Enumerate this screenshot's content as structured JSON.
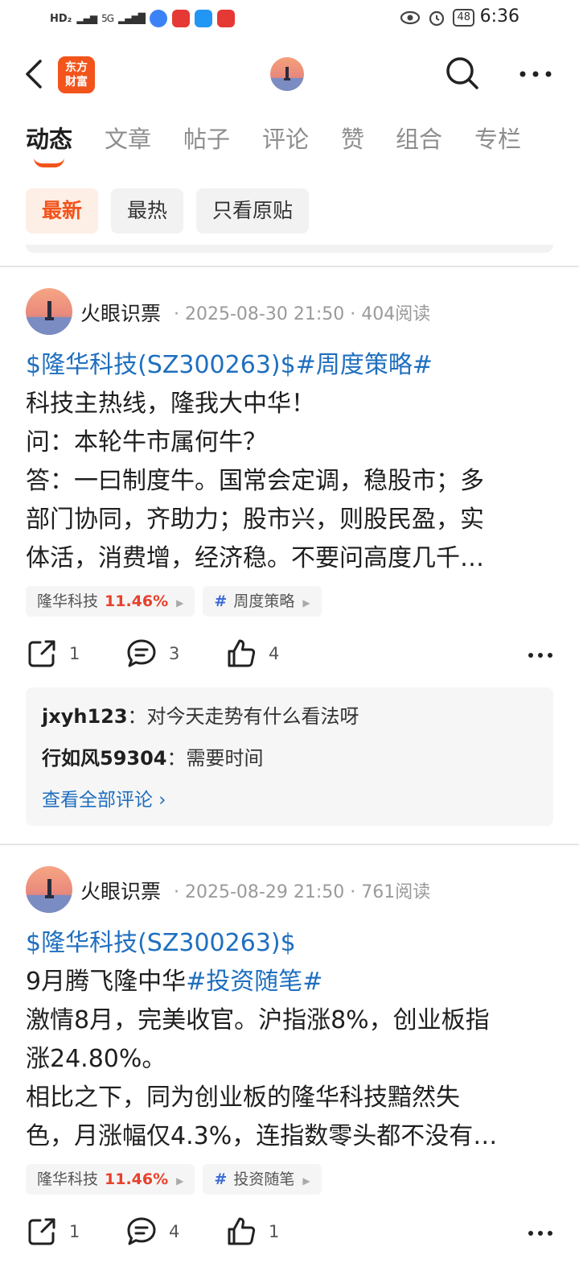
{
  "status_bar": {
    "hd_label": "HD₂",
    "signal_label": "5G",
    "battery": "48",
    "time": "6:36",
    "apps": [
      "#3b82f6",
      "#e53935",
      "#2196f3",
      "#e53935"
    ]
  },
  "navbar": {
    "logo_line1": "东方",
    "logo_line2": "财富",
    "back_icon": "chevron-left-icon",
    "search_icon": "search-icon",
    "more_icon": "more-dots-icon"
  },
  "tabs": [
    {
      "label": "动态",
      "active": true
    },
    {
      "label": "文章",
      "active": false
    },
    {
      "label": "帖子",
      "active": false
    },
    {
      "label": "评论",
      "active": false
    },
    {
      "label": "赞",
      "active": false
    },
    {
      "label": "组合",
      "active": false
    },
    {
      "label": "专栏",
      "active": false
    }
  ],
  "filters": [
    {
      "label": "最新",
      "active": true
    },
    {
      "label": "最热",
      "active": false
    },
    {
      "label": "只看原贴",
      "active": false
    }
  ],
  "posts": [
    {
      "author": "火眼识票",
      "meta": "· 2025-08-30 21:50 · 404阅读",
      "lines": [
        {
          "parts": [
            {
              "text": "$隆华科技(SZ300263)$#周度策略#",
              "link": true
            }
          ]
        },
        {
          "parts": [
            {
              "text": "科技主热线，隆我大中华！",
              "link": false
            }
          ]
        },
        {
          "parts": [
            {
              "text": "问：本轮牛市属何牛？",
              "link": false
            }
          ]
        },
        {
          "parts": [
            {
              "text": "答：一曰制度牛。国常会定调，稳股市；多",
              "link": false
            }
          ]
        },
        {
          "parts": [
            {
              "text": "部门协同，齐助力；股市兴，则股民盈，实",
              "link": false
            }
          ]
        },
        {
          "parts": [
            {
              "text": "体活，消费增，经济稳。不要问高度几千…",
              "link": false
            }
          ]
        }
      ],
      "stock_tag": {
        "name": "隆华科技",
        "change": "11.46%"
      },
      "topic_tag": {
        "name": "周度策略"
      },
      "actions": {
        "share": "1",
        "comment": "3",
        "like": "4"
      },
      "comments": [
        {
          "user": "jxyh123",
          "text": "：对今天走势有什么看法呀"
        },
        {
          "user": "行如风59304",
          "text": "：需要时间"
        }
      ],
      "view_all": "查看全部评论 ›"
    },
    {
      "author": "火眼识票",
      "meta": "· 2025-08-29 21:50 · 761阅读",
      "lines": [
        {
          "parts": [
            {
              "text": "$隆华科技(SZ300263)$",
              "link": true
            }
          ]
        },
        {
          "parts": [
            {
              "text": "9月腾飞隆中华",
              "link": false
            },
            {
              "text": "#投资随笔#",
              "link": true
            }
          ]
        },
        {
          "parts": [
            {
              "text": "激情8月，完美收官。沪指涨8%，创业板指",
              "link": false
            }
          ]
        },
        {
          "parts": [
            {
              "text": "涨24.80%。",
              "link": false
            }
          ]
        },
        {
          "parts": [
            {
              "text": "相比之下，同为创业板的隆华科技黯然失",
              "link": false
            }
          ]
        },
        {
          "parts": [
            {
              "text": "色，月涨幅仅4.3%，连指数零头都不没有…",
              "link": false
            }
          ]
        }
      ],
      "stock_tag": {
        "name": "隆华科技",
        "change": "11.46%"
      },
      "topic_tag": {
        "name": "投资随笔"
      },
      "actions": {
        "share": "1",
        "comment": "4",
        "like": "1"
      }
    }
  ],
  "colors": {
    "accent": "#f2541b",
    "link": "#1f6fbf",
    "rise": "#e8412c"
  }
}
